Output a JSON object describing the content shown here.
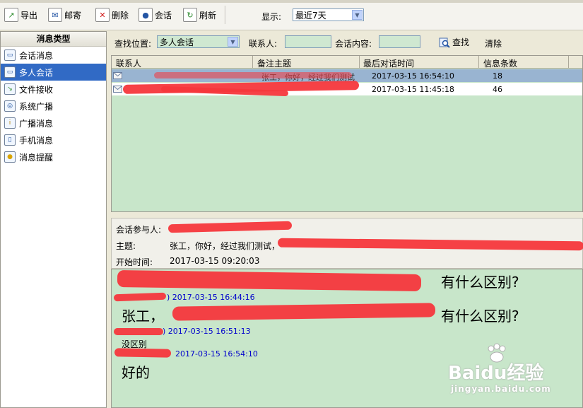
{
  "toolbar": {
    "buttons": [
      {
        "label": "导出",
        "icon": "export-icon"
      },
      {
        "label": "邮寄",
        "icon": "mail-icon"
      },
      {
        "label": "删除",
        "icon": "delete-icon"
      },
      {
        "label": "会话",
        "icon": "chat-icon"
      },
      {
        "label": "刷新",
        "icon": "refresh-icon"
      }
    ],
    "display_label": "显示:",
    "display_value": "最近7天"
  },
  "sidebar": {
    "title": "消息类型",
    "items": [
      {
        "label": "会话消息",
        "icon": "chat-message-icon"
      },
      {
        "label": "多人会话",
        "icon": "group-chat-icon"
      },
      {
        "label": "文件接收",
        "icon": "file-receive-icon"
      },
      {
        "label": "系统广播",
        "icon": "system-broadcast-icon"
      },
      {
        "label": "广播消息",
        "icon": "broadcast-message-icon"
      },
      {
        "label": "手机消息",
        "icon": "mobile-message-icon"
      },
      {
        "label": "消息提醒",
        "icon": "reminder-icon"
      }
    ],
    "active_index": 1
  },
  "search": {
    "location_label": "查找位置:",
    "location_value": "多人会话",
    "contact_label": "联系人:",
    "content_label": "会话内容:",
    "find_label": "查找",
    "clear_label": "清除"
  },
  "table": {
    "columns": [
      "联系人",
      "备注主题",
      "最后对话时间",
      "信息条数"
    ],
    "rows": [
      {
        "last_time": "2017-03-15 16:54:10",
        "count": "18",
        "subject_fragment": "张工，你好，经过我们测试"
      },
      {
        "last_time": "2017-03-15 11:45:18",
        "count": "46",
        "subject_fragment": ""
      }
    ]
  },
  "detail": {
    "participants_label": "会话参与人:",
    "subject_label": "主题:",
    "subject_value": "张工，你好，经过我们测试，",
    "start_label": "开始时间:",
    "start_value": "2017-03-15 09:20:03"
  },
  "messages": [
    {
      "meta": ") 2017-03-15  16:44:16",
      "text": ""
    },
    {
      "meta": "",
      "text": "张工，"
    },
    {
      "meta": ") 2017-03-15  16:51:13",
      "text": ""
    },
    {
      "meta": "",
      "text": "没区别"
    },
    {
      "meta": "2017-03-15  16:54:10",
      "text": ""
    },
    {
      "meta": "",
      "text": "好的"
    }
  ],
  "message_tails": [
    "有什么区别?",
    "有什么区别?"
  ],
  "watermark": {
    "brand": "Baidu经验",
    "url": "jingyan.baidu.com"
  }
}
